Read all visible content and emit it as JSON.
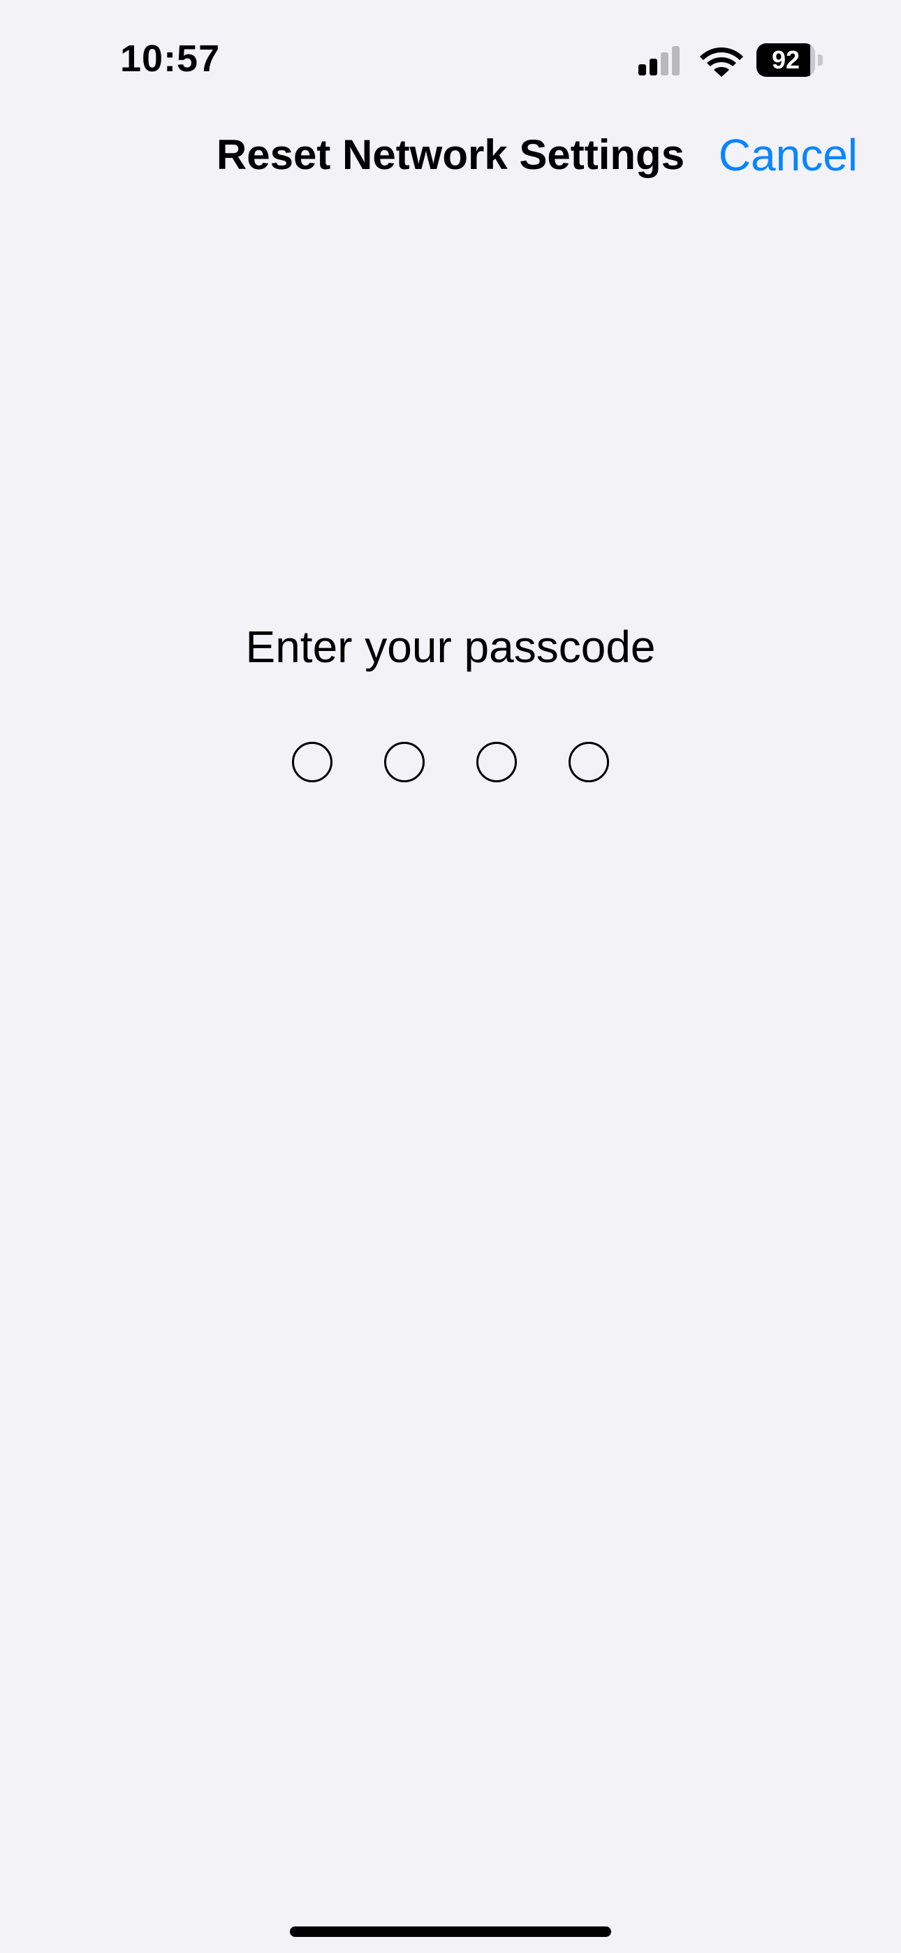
{
  "status_bar": {
    "time": "10:57",
    "signal_icon": "cellular-signal-icon",
    "signal_bars_active": 2,
    "signal_bars_total": 4,
    "wifi_icon": "wifi-icon",
    "battery_icon": "battery-icon",
    "battery_level": "92",
    "battery_fraction": 0.92
  },
  "nav": {
    "title": "Reset Network Settings",
    "cancel_label": "Cancel"
  },
  "passcode": {
    "prompt": "Enter your passcode",
    "digit_count": 4,
    "digits_entered": 0
  },
  "colors": {
    "background": "#f2f2f7",
    "accent": "#0a84ff",
    "text": "#000000"
  }
}
